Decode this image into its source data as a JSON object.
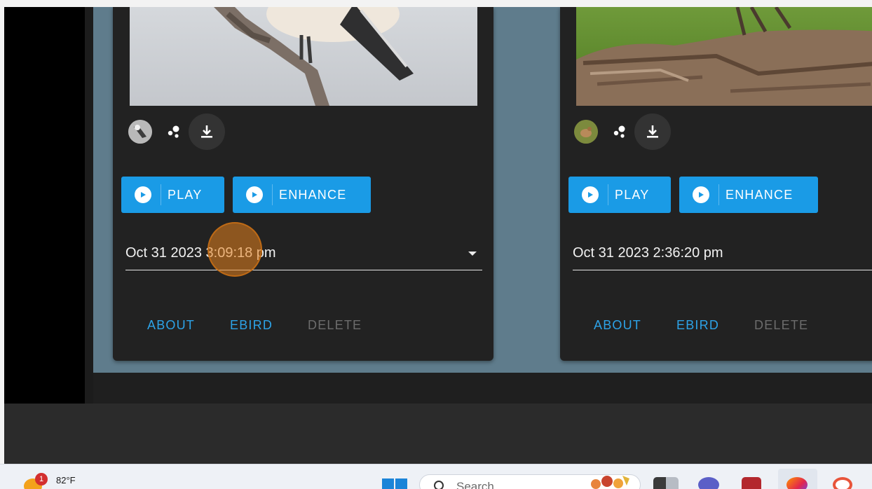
{
  "cards": [
    {
      "play_label": "PLAY",
      "enhance_label": "ENHANCE",
      "recording_time": "Oct 31 2023 3:09:18 pm",
      "links": {
        "about": "ABOUT",
        "ebird": "EBIRD",
        "delete": "DELETE"
      }
    },
    {
      "play_label": "PLAY",
      "enhance_label": "ENHANCE",
      "recording_time": "Oct 31 2023 2:36:20 pm",
      "links": {
        "about": "ABOUT",
        "ebird": "EBIRD",
        "delete": "DELETE"
      }
    }
  ],
  "taskbar": {
    "weather_badge": "1",
    "temperature": "82°F",
    "search_placeholder": "Search"
  },
  "colors": {
    "accent_blue": "#1a9be6",
    "card_background": "#222222",
    "panel_background": "#5f7c8c",
    "click_indicator": "#e6821e"
  }
}
